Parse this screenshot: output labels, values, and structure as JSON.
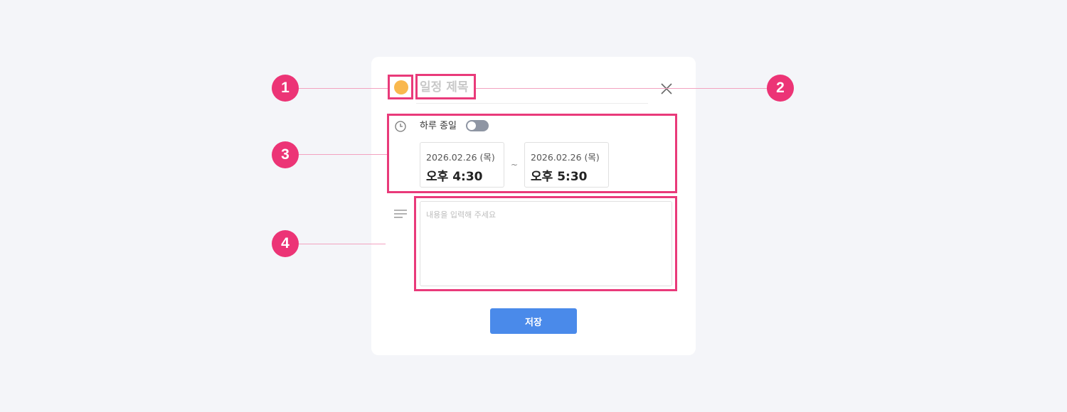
{
  "event_dialog": {
    "color_accent": "#f9b84e",
    "title_placeholder": "일정 제목",
    "allday_label": "하루 종일",
    "allday_enabled": false,
    "start": {
      "date": "2026.02.26 (목)",
      "time": "오후 4:30"
    },
    "separator": "~",
    "end": {
      "date": "2026.02.26 (목)",
      "time": "오후 5:30"
    },
    "memo_placeholder": "내용을 입력해 주세요",
    "save_label": "저장"
  },
  "annotations": {
    "highlight_color": "#e93a7a",
    "badges": [
      "1",
      "2",
      "3",
      "4"
    ]
  },
  "icons": [
    "close-icon",
    "clock-icon",
    "memo-lines-icon"
  ]
}
